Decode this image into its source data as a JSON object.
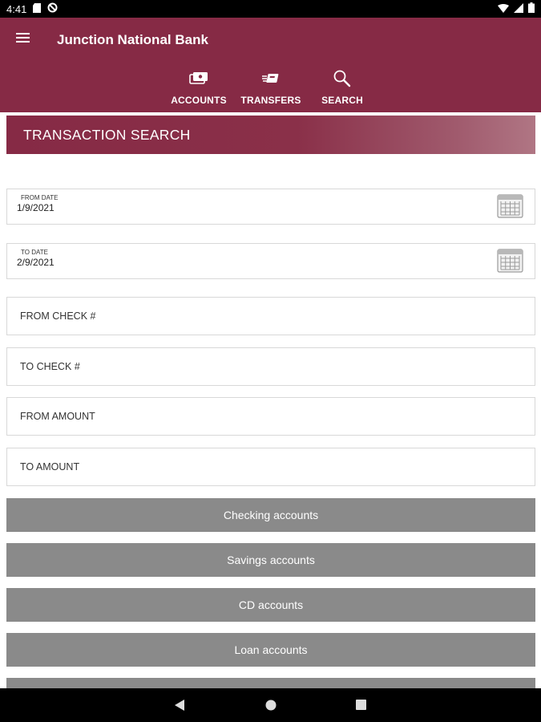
{
  "status_bar": {
    "time": "4:41"
  },
  "app": {
    "title": "Junction National Bank"
  },
  "nav": {
    "items": [
      {
        "label": "ACCOUNTS",
        "icon": "accounts-icon"
      },
      {
        "label": "TRANSFERS",
        "icon": "transfers-icon"
      },
      {
        "label": "SEARCH",
        "icon": "search-icon"
      }
    ]
  },
  "page": {
    "title": "TRANSACTION SEARCH"
  },
  "form": {
    "from_date": {
      "label": "FROM DATE",
      "value": "1/9/2021"
    },
    "to_date": {
      "label": "TO DATE",
      "value": "2/9/2021"
    },
    "from_check": {
      "placeholder": "FROM CHECK #"
    },
    "to_check": {
      "placeholder": "TO CHECK #"
    },
    "from_amount": {
      "placeholder": "FROM AMOUNT"
    },
    "to_amount": {
      "placeholder": "TO AMOUNT"
    }
  },
  "account_buttons": [
    {
      "label": "Checking accounts"
    },
    {
      "label": "Savings accounts"
    },
    {
      "label": "CD accounts"
    },
    {
      "label": "Loan accounts"
    }
  ],
  "colors": {
    "brand": "#862a45",
    "button_gray": "#8a8a8a"
  }
}
